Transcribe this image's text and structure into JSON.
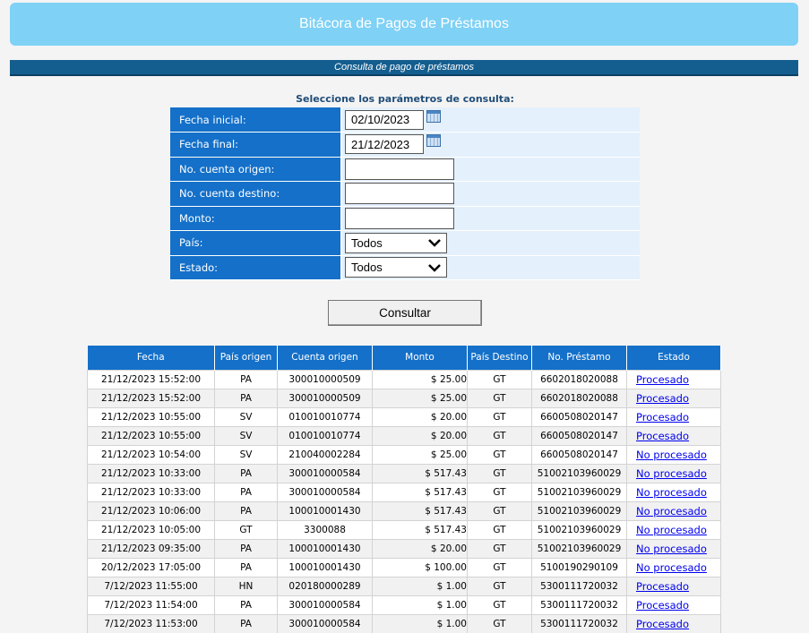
{
  "header": {
    "title": "Bitácora de Pagos de Préstamos"
  },
  "section": {
    "title": "Consulta de pago de préstamos"
  },
  "form": {
    "caption": "Seleccione los parámetros de consulta:",
    "fecha_inicial": {
      "label": "Fecha inicial:",
      "value": "02/10/2023"
    },
    "fecha_final": {
      "label": "Fecha final:",
      "value": "21/12/2023"
    },
    "cuenta_origen": {
      "label": "No. cuenta origen:",
      "value": ""
    },
    "cuenta_destino": {
      "label": "No. cuenta destino:",
      "value": ""
    },
    "monto": {
      "label": "Monto:",
      "value": ""
    },
    "pais": {
      "label": "País:",
      "value": "Todos"
    },
    "estado": {
      "label": "Estado:",
      "value": "Todos"
    },
    "submit_label": "Consultar"
  },
  "icons": {
    "calendar": "calendar-icon",
    "dropdown": "chevron-down-icon"
  },
  "colors": {
    "banner": "#7fd1f5",
    "section": "#145e8f",
    "header_cell": "#1470c9",
    "link": "#0000ee"
  },
  "table": {
    "headers": [
      "Fecha",
      "País origen",
      "Cuenta origen",
      "Monto",
      "País Destino",
      "No. Préstamo",
      "Estado"
    ],
    "rows": [
      [
        "21/12/2023 15:52:00",
        "PA",
        "300010000509",
        "$ 25.00",
        "GT",
        "6602018020088",
        "Procesado"
      ],
      [
        "21/12/2023 15:52:00",
        "PA",
        "300010000509",
        "$ 25.00",
        "GT",
        "6602018020088",
        "Procesado"
      ],
      [
        "21/12/2023 10:55:00",
        "SV",
        "010010010774",
        "$ 20.00",
        "GT",
        "6600508020147",
        "Procesado"
      ],
      [
        "21/12/2023 10:55:00",
        "SV",
        "010010010774",
        "$ 20.00",
        "GT",
        "6600508020147",
        "Procesado"
      ],
      [
        "21/12/2023 10:54:00",
        "SV",
        "210040002284",
        "$ 25.00",
        "GT",
        "6600508020147",
        "No procesado"
      ],
      [
        "21/12/2023 10:33:00",
        "PA",
        "300010000584",
        "$ 517.43",
        "GT",
        "51002103960029",
        "No procesado"
      ],
      [
        "21/12/2023 10:33:00",
        "PA",
        "300010000584",
        "$ 517.43",
        "GT",
        "51002103960029",
        "No procesado"
      ],
      [
        "21/12/2023 10:06:00",
        "PA",
        "100010001430",
        "$ 517.43",
        "GT",
        "51002103960029",
        "No procesado"
      ],
      [
        "21/12/2023 10:05:00",
        "GT",
        "3300088",
        "$ 517.43",
        "GT",
        "51002103960029",
        "No procesado"
      ],
      [
        "21/12/2023 09:35:00",
        "PA",
        "100010001430",
        "$ 20.00",
        "GT",
        "51002103960029",
        "No procesado"
      ],
      [
        "20/12/2023 17:05:00",
        "PA",
        "100010001430",
        "$ 100.00",
        "GT",
        "5100190290109",
        "No procesado"
      ],
      [
        "7/12/2023 11:55:00",
        "HN",
        "020180000289",
        "$ 1.00",
        "GT",
        "5300111720032",
        "Procesado"
      ],
      [
        "7/12/2023 11:54:00",
        "PA",
        "300010000584",
        "$ 1.00",
        "GT",
        "5300111720032",
        "Procesado"
      ],
      [
        "7/12/2023 11:53:00",
        "PA",
        "300010000584",
        "$ 1.00",
        "GT",
        "5300111720032",
        "Procesado"
      ]
    ]
  }
}
